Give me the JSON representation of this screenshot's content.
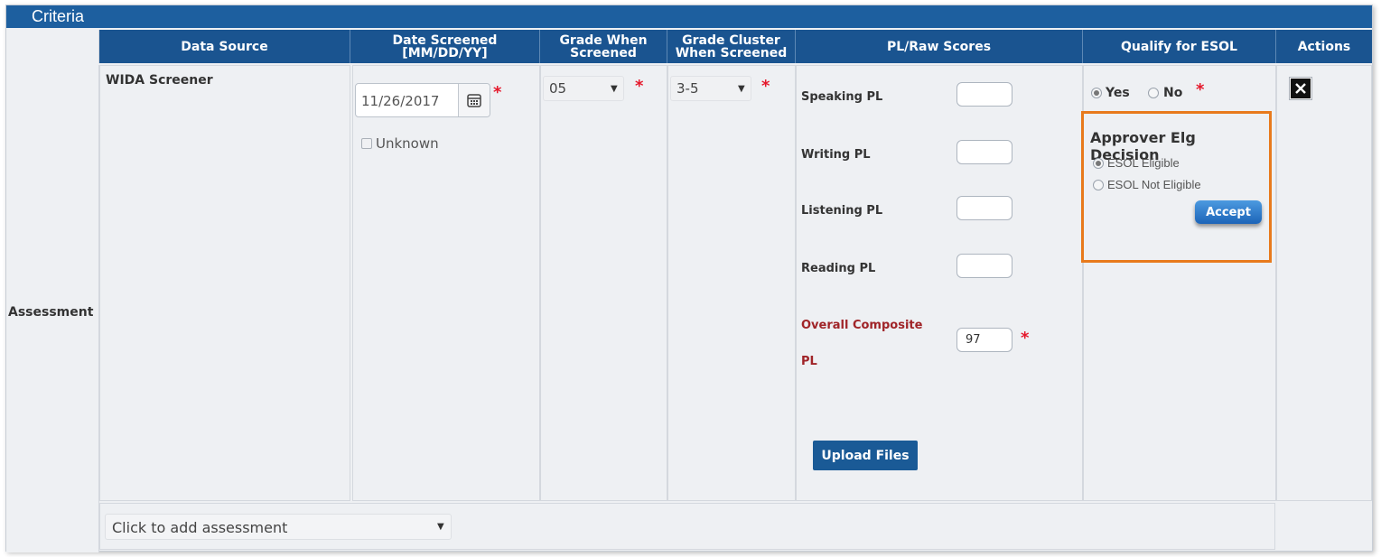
{
  "panel": {
    "title": "Criteria"
  },
  "columns": {
    "data_source": "Data Source",
    "date_screened_1": "Date Screened",
    "date_screened_2": "[MM/DD/YY]",
    "grade_when_1": "Grade When",
    "grade_when_2": "Screened",
    "grade_cluster_1": "Grade Cluster",
    "grade_cluster_2": "When Screened",
    "pl_raw": "PL/Raw Scores",
    "qualify": "Qualify for ESOL",
    "actions": "Actions"
  },
  "row": {
    "label": "Assessment",
    "data_source": "WIDA Screener",
    "date_value": "11/26/2017",
    "unknown_label": "Unknown",
    "grade_value": "05",
    "grade_cluster_value": "3-5",
    "required_mark": "*"
  },
  "scores": {
    "speaking": "Speaking PL",
    "writing": "Writing PL",
    "listening": "Listening PL",
    "reading": "Reading PL",
    "overall_1": "Overall Composite",
    "overall_2": "PL",
    "overall_value": "97",
    "upload_button": "Upload Files"
  },
  "qualify": {
    "yes": "Yes",
    "no": "No",
    "yes_selected": true,
    "approver_title": "Approver Elg Decision",
    "eligible": "ESOL Eligible",
    "not_eligible": "ESOL Not Eligible",
    "eligible_selected": true,
    "accept_button": "Accept"
  },
  "actions": {
    "delete_icon": "close-icon"
  },
  "footer": {
    "add_assessment_placeholder": "Click to add assessment"
  },
  "colors": {
    "header": "#1a5490",
    "title_bar": "#1d5f9f",
    "highlight_border": "#e87a1c",
    "required": "#e5182b",
    "overall_label": "#a02428"
  }
}
